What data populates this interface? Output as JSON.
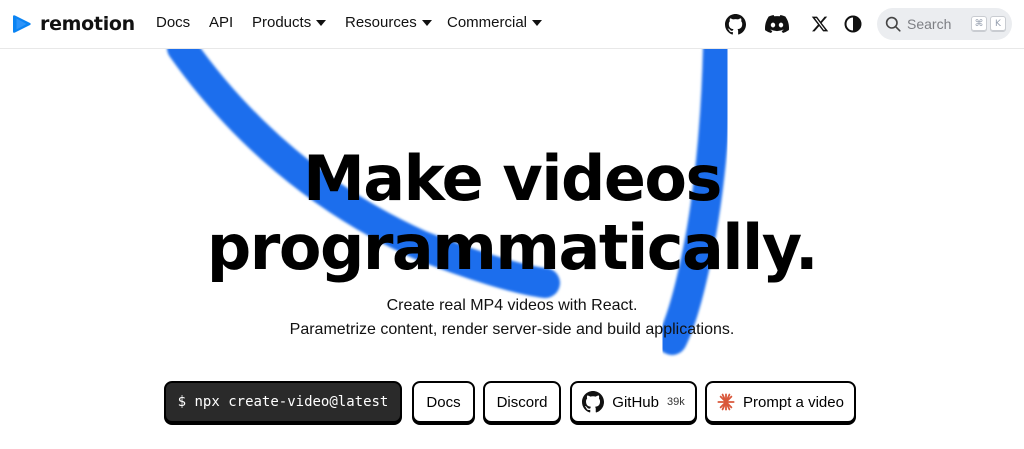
{
  "brand": {
    "name": "remotion",
    "accent": "#0b84f3"
  },
  "nav": {
    "docs": "Docs",
    "api": "API",
    "products": "Products",
    "resources": "Resources",
    "commercial": "Commercial"
  },
  "header_icons": [
    "github-icon",
    "discord-icon",
    "x-icon",
    "theme-toggle-icon"
  ],
  "search": {
    "label": "Search",
    "shortcut_mod": "⌘",
    "shortcut_key": "K"
  },
  "hero": {
    "title_line1": "Make videos",
    "title_line2": "programmatically.",
    "sub_line1": "Create real MP4 videos with React.",
    "sub_line2": "Parametrize content, render server-side and build applications.",
    "stroke_color": "#1a6eed"
  },
  "buttons": {
    "command": "$ npx create-video@latest",
    "docs": "Docs",
    "discord": "Discord",
    "github": "GitHub",
    "github_stars": "39k",
    "prompt": "Prompt a video"
  }
}
